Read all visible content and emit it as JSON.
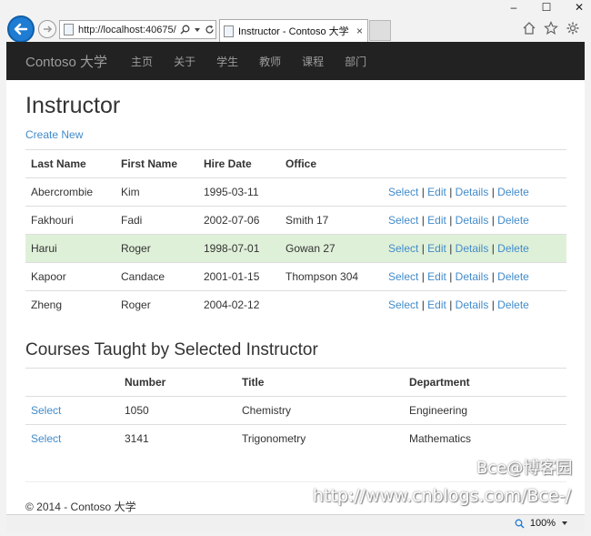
{
  "browser": {
    "url": "http://localhost:40675/",
    "tab_title": "Instructor - Contoso 大学",
    "tab_close": "×",
    "window_controls": [
      "–",
      "☐",
      "✕"
    ],
    "zoom": "100%",
    "icons": [
      "back-arrow-icon",
      "forward-arrow-icon",
      "search-icon",
      "refresh-icon",
      "home-icon",
      "favorites-star-icon",
      "settings-gear-icon"
    ]
  },
  "navbar": {
    "brand": "Contoso 大学",
    "links": [
      "主页",
      "关于",
      "学生",
      "教师",
      "课程",
      "部门"
    ]
  },
  "page": {
    "title": "Instructor",
    "create_new": "Create New"
  },
  "instructors": {
    "headers": [
      "Last Name",
      "First Name",
      "Hire Date",
      "Office"
    ],
    "actions": {
      "select": "Select",
      "edit": "Edit",
      "details": "Details",
      "delete": "Delete",
      "separator": "|"
    },
    "rows": [
      {
        "last": "Abercrombie",
        "first": "Kim",
        "hire": "1995-03-11",
        "office": ""
      },
      {
        "last": "Fakhouri",
        "first": "Fadi",
        "hire": "2002-07-06",
        "office": "Smith 17"
      },
      {
        "last": "Harui",
        "first": "Roger",
        "hire": "1998-07-01",
        "office": "Gowan 27"
      },
      {
        "last": "Kapoor",
        "first": "Candace",
        "hire": "2001-01-15",
        "office": "Thompson 304"
      },
      {
        "last": "Zheng",
        "first": "Roger",
        "hire": "2004-02-12",
        "office": ""
      }
    ]
  },
  "courses": {
    "title": "Courses Taught by Selected Instructor",
    "headers": [
      "",
      "Number",
      "Title",
      "Department"
    ],
    "rows": [
      {
        "action": "Select",
        "number": "1050",
        "title": "Chemistry",
        "department": "Engineering"
      },
      {
        "action": "Select",
        "number": "3141",
        "title": "Trigonometry",
        "department": "Mathematics"
      }
    ]
  },
  "footer": {
    "text": "© 2014 - Contoso 大学"
  },
  "watermark": {
    "line1": "Bce@博客园",
    "line2": "http://www.cnblogs.com/Bce-/"
  },
  "colors": {
    "link": "#428bca",
    "navbar": "#222222",
    "selected_row": "#dff0d8",
    "back_button": "#1f7cd3"
  }
}
